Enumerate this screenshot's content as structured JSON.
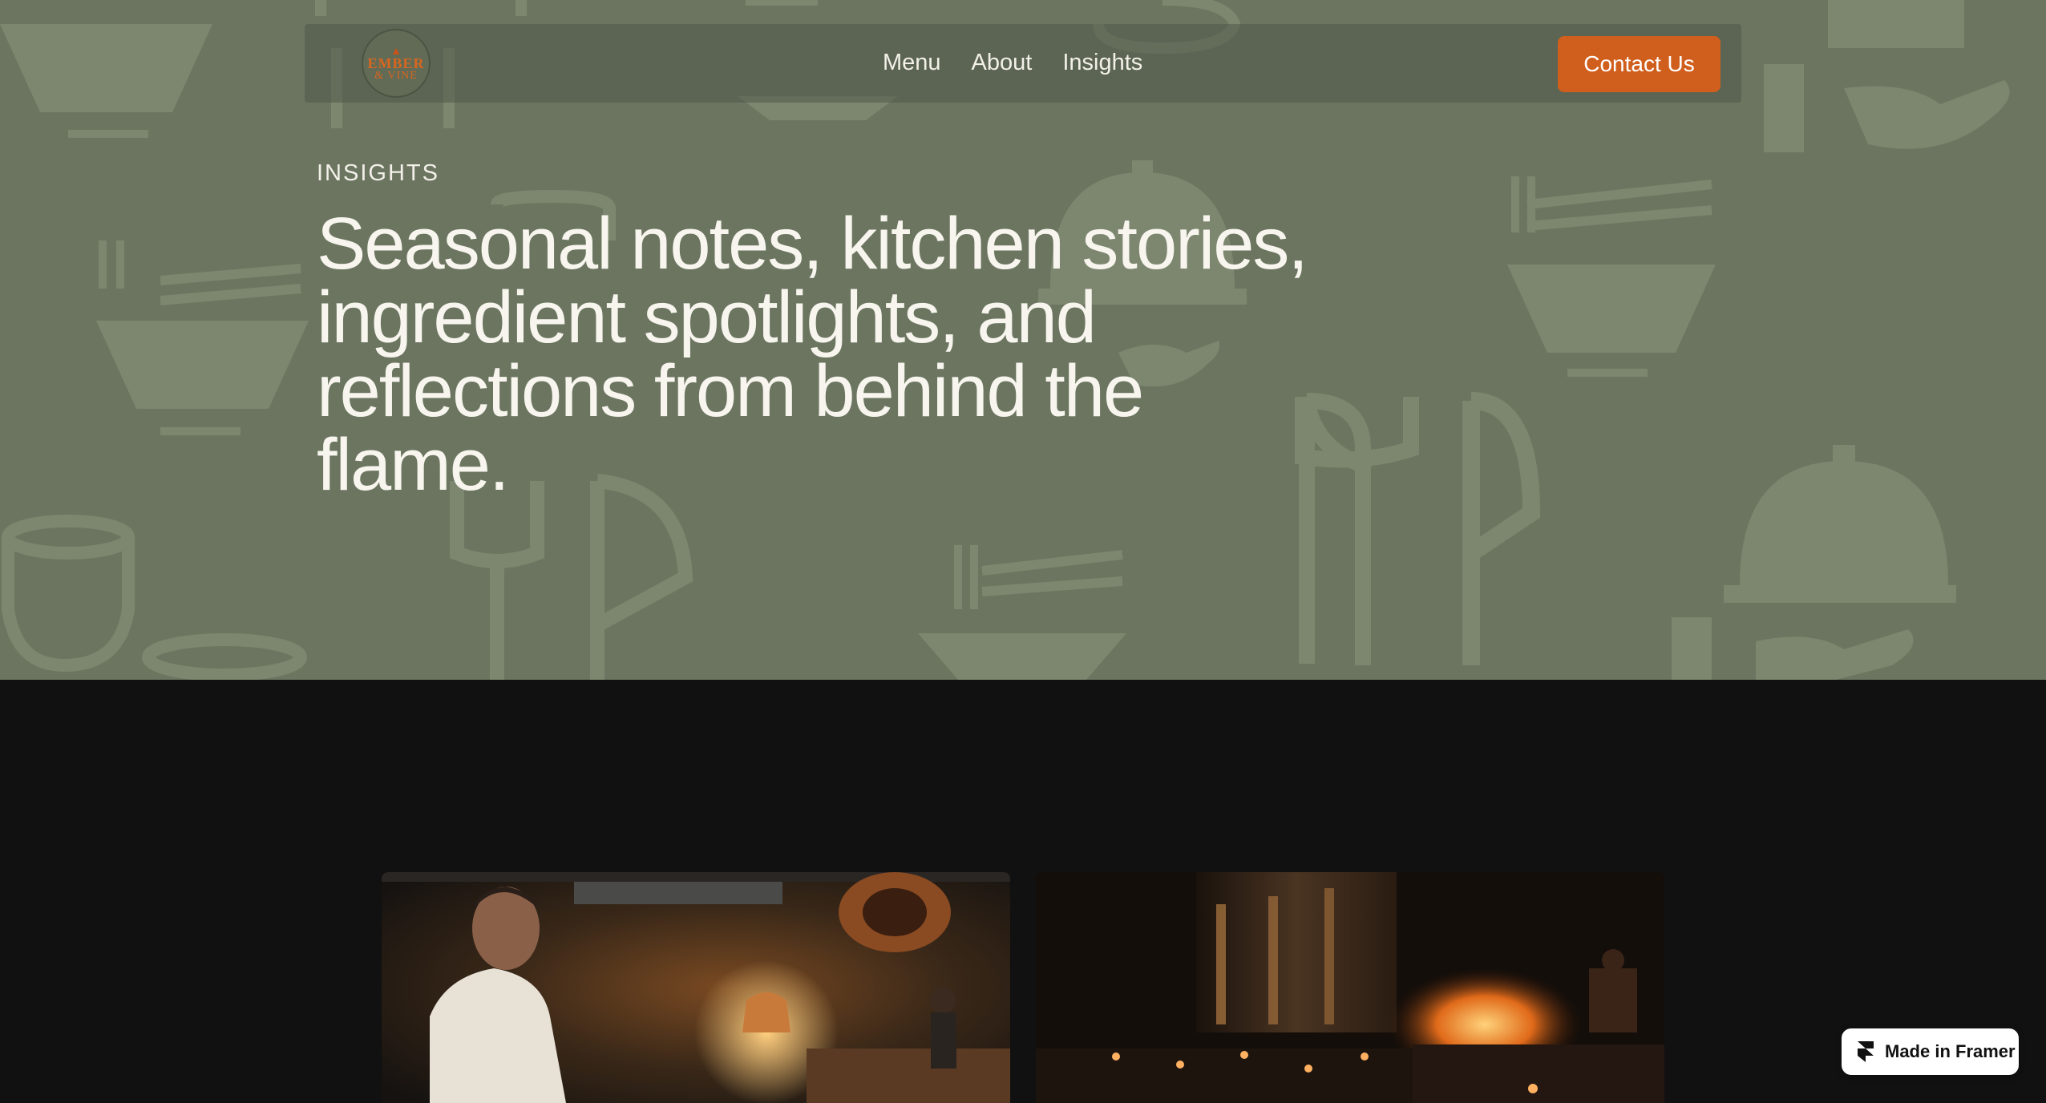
{
  "brand": {
    "logo_line1": "EMBER",
    "logo_line2": "& VINE",
    "accent_color": "#d05e1c",
    "hero_bg_color": "#6b7560"
  },
  "nav": {
    "items": [
      {
        "label": "Menu"
      },
      {
        "label": "About"
      },
      {
        "label": "Insights"
      }
    ],
    "cta_label": "Contact Us"
  },
  "hero": {
    "eyebrow": "INSIGHTS",
    "headline": "Seasonal notes, kitchen stories, ingredient spotlights, and reflections from behind the flame."
  },
  "cards": [
    {
      "image": "chef-in-kitchen-image"
    },
    {
      "image": "restaurant-dining-room-image"
    }
  ],
  "badge": {
    "label": "Made in Framer",
    "icon": "framer-logo-icon"
  }
}
